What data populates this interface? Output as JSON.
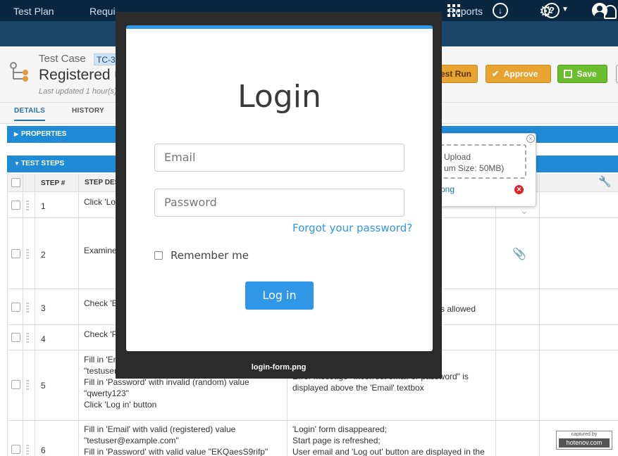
{
  "nav": {
    "items": [
      "Test Plan",
      "Requi",
      "Reports"
    ]
  },
  "header": {
    "kind": "Test Case",
    "badge": "TC-3",
    "title": "Registered u",
    "updated": "Last updated 1 hour(s)",
    "buttons": {
      "run": "est Run",
      "approve": "Approve",
      "save": "Save"
    }
  },
  "tabs": [
    "DETAILS",
    "HISTORY"
  ],
  "sections": {
    "properties": "PROPERTIES",
    "test_steps": "TEST STEPS"
  },
  "table": {
    "columns": [
      "STEP #",
      "STEP DES"
    ],
    "rows": [
      {
        "num": "1",
        "desc": [
          "Click 'Lo"
        ],
        "result": []
      },
      {
        "num": "2",
        "desc": [
          "Examine"
        ],
        "result": []
      },
      {
        "num": "3",
        "desc": [
          "Check 'E"
        ],
        "result": [
          "s allowed"
        ]
      },
      {
        "num": "4",
        "desc": [
          "Check 'P"
        ],
        "result": []
      },
      {
        "num": "5",
        "desc": [
          "Fill in 'Email' with valid (registered) value",
          "\"testuser@example.com\"",
          "Fill in 'Password' with invalid (random) value",
          "\"qwerty123\"",
          "Click 'Log in' button"
        ],
        "result": [
          "Error message \"Incorrect email or password\" is",
          "displayed above the 'Email' textbox"
        ]
      },
      {
        "num": "6",
        "desc": [
          "Fill in 'Email' with valid (registered) value",
          "\"testuser@example.com\"",
          "Fill in 'Password' with valid value \"EKQaesS9rifp\""
        ],
        "result": [
          "'Login' form disappeared;",
          "Start page is refreshed;",
          "User email and 'Log out' button are displayed in the"
        ]
      }
    ]
  },
  "upload": {
    "line1": "Upload",
    "line2": "um Size: 50MB)",
    "file": "png"
  },
  "login": {
    "title": "Login",
    "email_placeholder": "Email",
    "password_placeholder": "Password",
    "forgot": "Forgot your password?",
    "remember": "Remember me",
    "submit": "Log in"
  },
  "caption": "login-form.png",
  "watermark": {
    "top": "captured by",
    "bottom": "hotenov.com"
  },
  "icons": {
    "apps": "apps-grid-icon",
    "download": "download-icon",
    "help": "help-icon",
    "user": "user-icon",
    "gear": "gear-icon",
    "bell": "bell-icon",
    "attach": "paperclip-icon",
    "wrench": "wrench-icon"
  },
  "colors": {
    "topbar": "#0b2740",
    "navbar": "#1b4566",
    "section": "#1f8bd6",
    "login_accent": "#2f97e6",
    "approve": "#e8a431",
    "save": "#6bbf2f"
  }
}
